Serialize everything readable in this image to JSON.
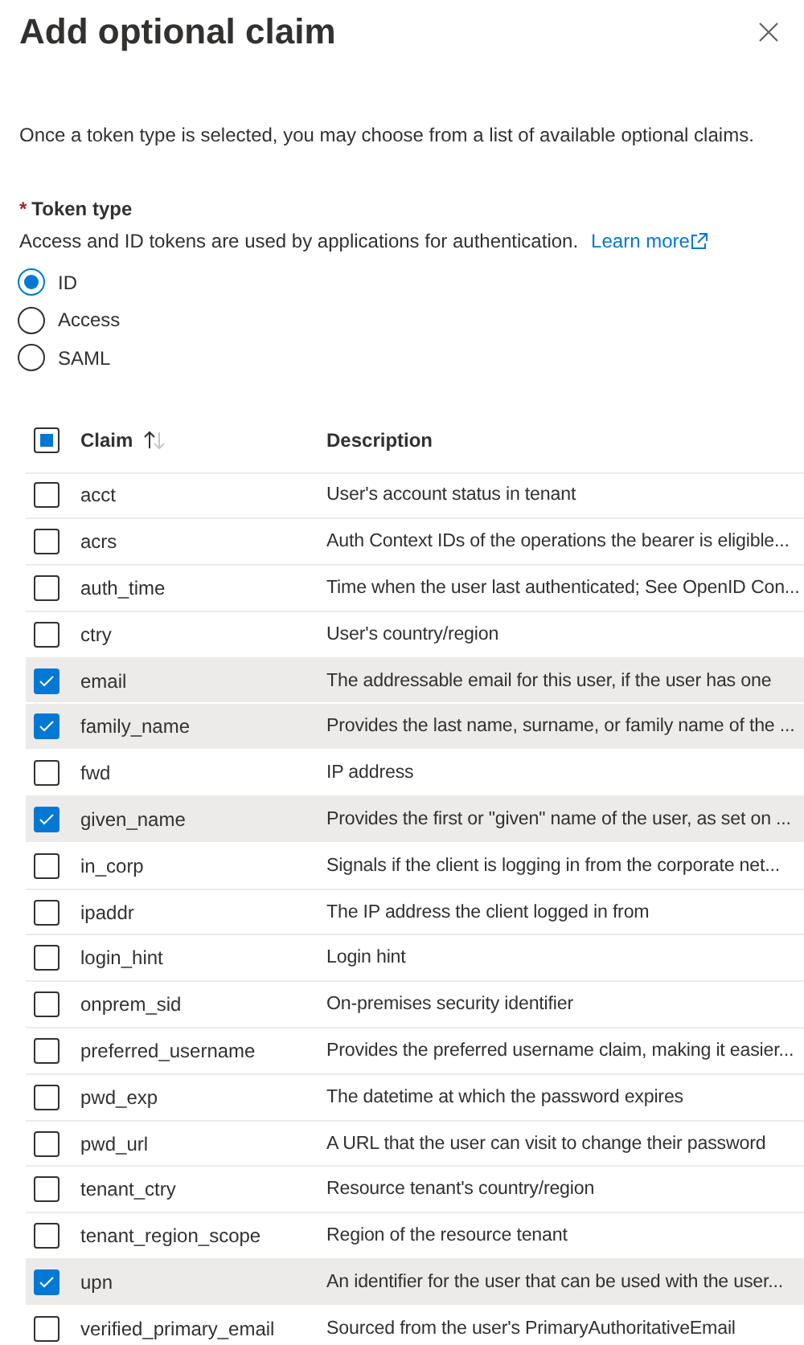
{
  "panel": {
    "title": "Add optional claim"
  },
  "intro": "Once a token type is selected, you may choose from a list of available optional claims.",
  "token_type": {
    "required_mark": "*",
    "label": "Token type",
    "help": "Access and ID tokens are used by applications for authentication.",
    "link": "Learn more",
    "options": [
      {
        "label": "ID",
        "selected": true
      },
      {
        "label": "Access",
        "selected": false
      },
      {
        "label": "SAML",
        "selected": false
      }
    ]
  },
  "table": {
    "select_all_partial": true,
    "columns": [
      {
        "label": "Claim",
        "sorted_ascending": true
      },
      {
        "label": "Description"
      }
    ],
    "rows": [
      {
        "claim": "acct",
        "description": "User's account status in tenant",
        "checked": false
      },
      {
        "claim": "acrs",
        "description": "Auth Context IDs of the operations the bearer is eligible...",
        "checked": false
      },
      {
        "claim": "auth_time",
        "description": "Time when the user last authenticated; See OpenID Con...",
        "checked": false
      },
      {
        "claim": "ctry",
        "description": "User's country/region",
        "checked": false
      },
      {
        "claim": "email",
        "description": "The addressable email for this user, if the user has one",
        "checked": true
      },
      {
        "claim": "family_name",
        "description": "Provides the last name, surname, or family name of the ...",
        "checked": true
      },
      {
        "claim": "fwd",
        "description": "IP address",
        "checked": false
      },
      {
        "claim": "given_name",
        "description": "Provides the first or \"given\" name of the user, as set on ...",
        "checked": true
      },
      {
        "claim": "in_corp",
        "description": "Signals if the client is logging in from the corporate net...",
        "checked": false
      },
      {
        "claim": "ipaddr",
        "description": "The IP address the client logged in from",
        "checked": false
      },
      {
        "claim": "login_hint",
        "description": "Login hint",
        "checked": false
      },
      {
        "claim": "onprem_sid",
        "description": "On-premises security identifier",
        "checked": false
      },
      {
        "claim": "preferred_username",
        "description": "Provides the preferred username claim, making it easier...",
        "checked": false
      },
      {
        "claim": "pwd_exp",
        "description": "The datetime at which the password expires",
        "checked": false
      },
      {
        "claim": "pwd_url",
        "description": "A URL that the user can visit to change their password",
        "checked": false
      },
      {
        "claim": "tenant_ctry",
        "description": "Resource tenant's country/region",
        "checked": false
      },
      {
        "claim": "tenant_region_scope",
        "description": "Region of the resource tenant",
        "checked": false
      },
      {
        "claim": "upn",
        "description": "An identifier for the user that can be used with the user...",
        "checked": true
      },
      {
        "claim": "verified_primary_email",
        "description": "Sourced from the user's PrimaryAuthoritativeEmail",
        "checked": false
      }
    ]
  }
}
